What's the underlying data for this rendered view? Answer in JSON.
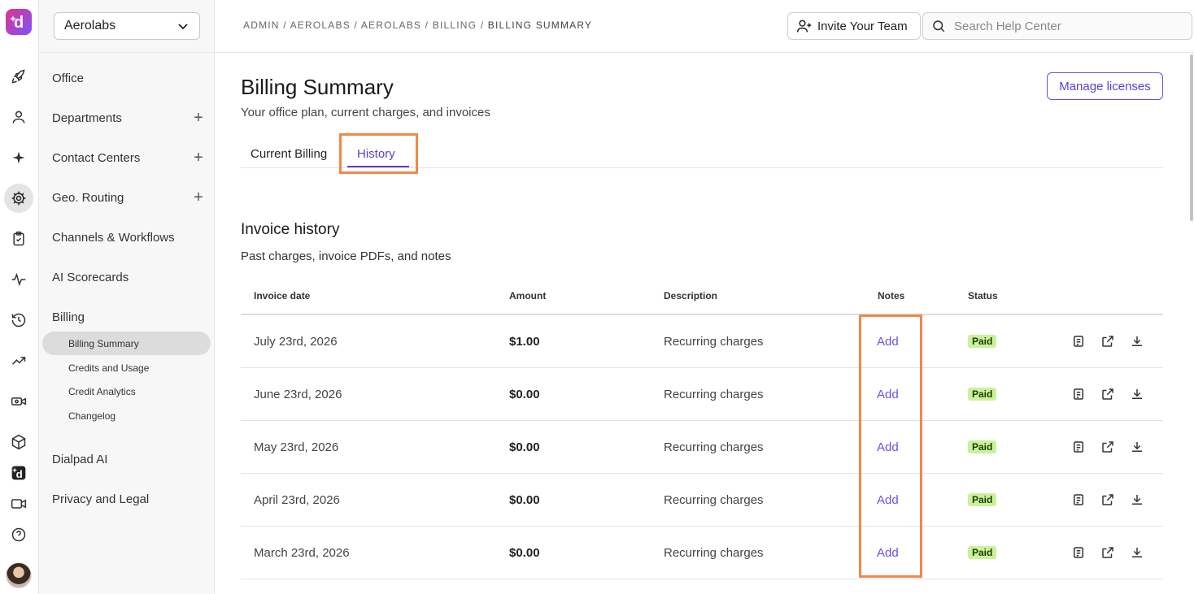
{
  "sidebar": {
    "org_name": "Aerolabs",
    "items": [
      {
        "label": "Office",
        "has_add": false
      },
      {
        "label": "Departments",
        "has_add": true
      },
      {
        "label": "Contact Centers",
        "has_add": true
      },
      {
        "label": "Geo. Routing",
        "has_add": true
      },
      {
        "label": "Channels & Workflows",
        "has_add": false
      },
      {
        "label": "AI Scorecards",
        "has_add": false
      },
      {
        "label": "Billing",
        "has_add": false
      }
    ],
    "billing_sub": [
      {
        "label": "Billing Summary",
        "active": true
      },
      {
        "label": "Credits and Usage",
        "active": false
      },
      {
        "label": "Credit Analytics",
        "active": false
      },
      {
        "label": "Changelog",
        "active": false
      }
    ],
    "after_items": [
      {
        "label": "Dialpad AI"
      },
      {
        "label": "Privacy and Legal"
      }
    ],
    "add_symbol": "+"
  },
  "rail_icons": [
    "rocket-icon",
    "person-icon",
    "sparkle-icon",
    "gear-icon",
    "clipboard-icon",
    "pulse-icon",
    "history-icon",
    "trending-icon",
    "video-settings-icon",
    "cube-icon",
    "dialpad-ai-icon",
    "video-icon",
    "help-icon"
  ],
  "topbar": {
    "breadcrumb": "ADMIN / AEROLABS / AEROLABS / BILLING / ",
    "breadcrumb_current": "BILLING SUMMARY",
    "invite_label": "Invite Your Team",
    "search_placeholder": "Search Help Center"
  },
  "page": {
    "title": "Billing Summary",
    "subtitle": "Your office plan, current charges, and invoices",
    "manage_label": "Manage licenses",
    "tabs": [
      "Current Billing",
      "History"
    ],
    "active_tab": "History"
  },
  "invoices": {
    "title": "Invoice history",
    "subtitle": "Past charges, invoice PDFs, and notes",
    "columns": [
      "Invoice date",
      "Amount",
      "Description",
      "Notes",
      "Status"
    ],
    "rows": [
      {
        "date": "July 23rd, 2026",
        "amount": "$1.00",
        "description": "Recurring charges",
        "note": "Add",
        "status": "Paid"
      },
      {
        "date": "June 23rd, 2026",
        "amount": "$0.00",
        "description": "Recurring charges",
        "note": "Add",
        "status": "Paid"
      },
      {
        "date": "May 23rd, 2026",
        "amount": "$0.00",
        "description": "Recurring charges",
        "note": "Add",
        "status": "Paid"
      },
      {
        "date": "April 23rd, 2026",
        "amount": "$0.00",
        "description": "Recurring charges",
        "note": "Add",
        "status": "Paid"
      },
      {
        "date": "March 23rd, 2026",
        "amount": "$0.00",
        "description": "Recurring charges",
        "note": "Add",
        "status": "Paid"
      }
    ],
    "row_icons": [
      "document-icon",
      "external-link-icon",
      "download-icon"
    ]
  },
  "colors": {
    "accent": "#5b3fd6",
    "highlight": "#f0884a",
    "paid_badge": "#c9f29b"
  }
}
